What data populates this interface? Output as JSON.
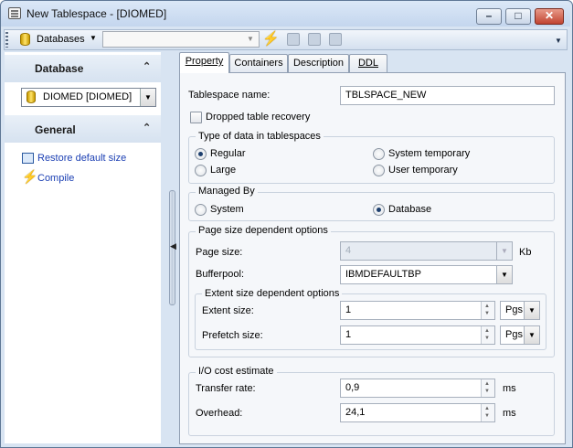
{
  "window": {
    "title": "New Tablespace - [DIOMED]"
  },
  "toolbar": {
    "databases_label": "Databases",
    "combo_value": ""
  },
  "sidebar": {
    "database_section": "Database",
    "db_selected": "DIOMED [DIOMED]",
    "general_section": "General",
    "links": [
      "Restore default size",
      "Compile"
    ]
  },
  "tabs": [
    "Property",
    "Containers",
    "Description",
    "DDL"
  ],
  "form": {
    "tablespace_name_label": "Tablespace name:",
    "tablespace_name_value": "TBLSPACE_NEW",
    "dropped_recovery_label": "Dropped table recovery",
    "type_group_title": "Type of data in tablespaces",
    "type_options": [
      "Regular",
      "Large",
      "System temporary",
      "User temporary"
    ],
    "type_selected": "Regular",
    "managed_group_title": "Managed By",
    "managed_options": [
      "System",
      "Database"
    ],
    "managed_selected": "Database",
    "page_group_title": "Page size dependent options",
    "page_size_label": "Page size:",
    "page_size_value": "4",
    "page_size_unit": "Kb",
    "bufferpool_label": "Bufferpool:",
    "bufferpool_value": "IBMDEFAULTBP",
    "extent_group_title": "Extent size dependent options",
    "extent_size_label": "Extent size:",
    "extent_size_value": "1",
    "extent_size_unit": "Pgs",
    "prefetch_size_label": "Prefetch size:",
    "prefetch_size_value": "1",
    "prefetch_size_unit": "Pgs",
    "io_group_title": "I/O cost estimate",
    "transfer_rate_label": "Transfer rate:",
    "transfer_rate_value": "0,9",
    "transfer_rate_unit": "ms",
    "overhead_label": "Overhead:",
    "overhead_value": "24,1",
    "overhead_unit": "ms"
  }
}
